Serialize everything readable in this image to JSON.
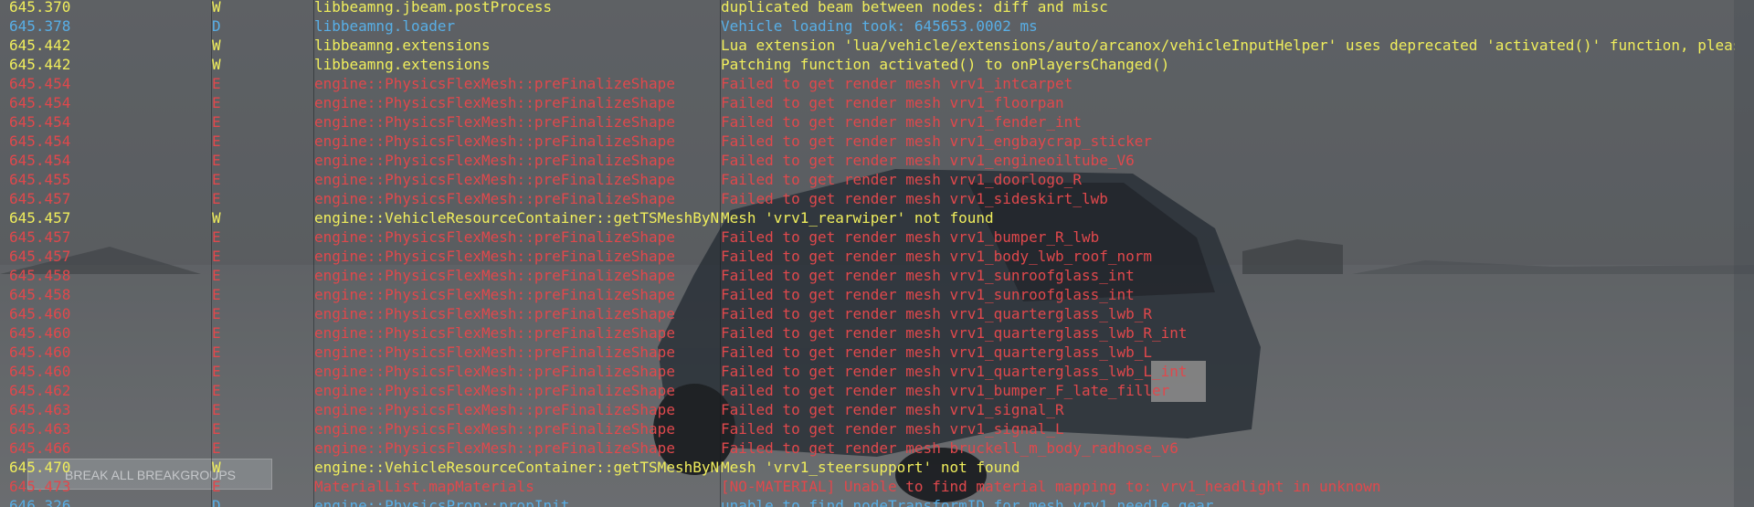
{
  "colors": {
    "error": "#e0484c",
    "warning": "#f0ee5c",
    "debug": "#58aee6",
    "console_bg": "rgba(0,0,0,0.35)"
  },
  "background_button": {
    "label": "BREAK ALL BREAKGROUPS"
  },
  "log": [
    {
      "time": "645.370",
      "level": "W",
      "source": "libbeamng.jbeam.postProcess",
      "message": "duplicated beam between nodes: diff and misc"
    },
    {
      "time": "645.378",
      "level": "D",
      "source": "libbeamng.loader",
      "message": "Vehicle loading took: 645653.0002 ms"
    },
    {
      "time": "645.442",
      "level": "W",
      "source": "libbeamng.extensions",
      "message": "Lua extension 'lua/vehicle/extensions/auto/arcanox/vehicleInputHelper' uses deprecated 'activated()' function, please"
    },
    {
      "time": "645.442",
      "level": "W",
      "source": "libbeamng.extensions",
      "message": "Patching function activated() to onPlayersChanged()"
    },
    {
      "time": "645.454",
      "level": "E",
      "source": "engine::PhysicsFlexMesh::preFinalizeShape",
      "message": "Failed to get render mesh vrv1_intcarpet"
    },
    {
      "time": "645.454",
      "level": "E",
      "source": "engine::PhysicsFlexMesh::preFinalizeShape",
      "message": "Failed to get render mesh vrv1_floorpan"
    },
    {
      "time": "645.454",
      "level": "E",
      "source": "engine::PhysicsFlexMesh::preFinalizeShape",
      "message": "Failed to get render mesh vrv1_fender_int"
    },
    {
      "time": "645.454",
      "level": "E",
      "source": "engine::PhysicsFlexMesh::preFinalizeShape",
      "message": "Failed to get render mesh vrv1_engbaycrap_sticker"
    },
    {
      "time": "645.454",
      "level": "E",
      "source": "engine::PhysicsFlexMesh::preFinalizeShape",
      "message": "Failed to get render mesh vrv1_engineoiltube_V6"
    },
    {
      "time": "645.455",
      "level": "E",
      "source": "engine::PhysicsFlexMesh::preFinalizeShape",
      "message": "Failed to get render mesh vrv1_doorlogo_R"
    },
    {
      "time": "645.457",
      "level": "E",
      "source": "engine::PhysicsFlexMesh::preFinalizeShape",
      "message": "Failed to get render mesh vrv1_sideskirt_lwb"
    },
    {
      "time": "645.457",
      "level": "W",
      "source": "engine::VehicleResourceContainer::getTSMeshByName",
      "message": "Mesh 'vrv1_rearwiper' not found"
    },
    {
      "time": "645.457",
      "level": "E",
      "source": "engine::PhysicsFlexMesh::preFinalizeShape",
      "message": "Failed to get render mesh vrv1_bumper_R_lwb"
    },
    {
      "time": "645.457",
      "level": "E",
      "source": "engine::PhysicsFlexMesh::preFinalizeShape",
      "message": "Failed to get render mesh vrv1_body_lwb_roof_norm"
    },
    {
      "time": "645.458",
      "level": "E",
      "source": "engine::PhysicsFlexMesh::preFinalizeShape",
      "message": "Failed to get render mesh vrv1_sunroofglass_int"
    },
    {
      "time": "645.458",
      "level": "E",
      "source": "engine::PhysicsFlexMesh::preFinalizeShape",
      "message": "Failed to get render mesh vrv1_sunroofglass_int"
    },
    {
      "time": "645.460",
      "level": "E",
      "source": "engine::PhysicsFlexMesh::preFinalizeShape",
      "message": "Failed to get render mesh vrv1_quarterglass_lwb_R"
    },
    {
      "time": "645.460",
      "level": "E",
      "source": "engine::PhysicsFlexMesh::preFinalizeShape",
      "message": "Failed to get render mesh vrv1_quarterglass_lwb_R_int"
    },
    {
      "time": "645.460",
      "level": "E",
      "source": "engine::PhysicsFlexMesh::preFinalizeShape",
      "message": "Failed to get render mesh vrv1_quarterglass_lwb_L"
    },
    {
      "time": "645.460",
      "level": "E",
      "source": "engine::PhysicsFlexMesh::preFinalizeShape",
      "message": "Failed to get render mesh vrv1_quarterglass_lwb_L_int"
    },
    {
      "time": "645.462",
      "level": "E",
      "source": "engine::PhysicsFlexMesh::preFinalizeShape",
      "message": "Failed to get render mesh vrv1_bumper_F_late_filler"
    },
    {
      "time": "645.463",
      "level": "E",
      "source": "engine::PhysicsFlexMesh::preFinalizeShape",
      "message": "Failed to get render mesh vrv1_signal_R"
    },
    {
      "time": "645.463",
      "level": "E",
      "source": "engine::PhysicsFlexMesh::preFinalizeShape",
      "message": "Failed to get render mesh vrv1_signal_L"
    },
    {
      "time": "645.466",
      "level": "E",
      "source": "engine::PhysicsFlexMesh::preFinalizeShape",
      "message": "Failed to get render mesh bruckell_m_body_radhose_v6"
    },
    {
      "time": "645.470",
      "level": "W",
      "source": "engine::VehicleResourceContainer::getTSMeshByName",
      "message": "Mesh 'vrv1_steersupport' not found"
    },
    {
      "time": "645.473",
      "level": "E",
      "source": "MaterialList.mapMaterials",
      "message": "[NO-MATERIAL] Unable to find material mapping to: vrv1_headlight in unknown"
    },
    {
      "time": "646.326",
      "level": "D",
      "source": "engine::PhysicsProp::propInit",
      "message": "unable to find nodeTransformID for mesh vrv1_needle_gear"
    }
  ]
}
